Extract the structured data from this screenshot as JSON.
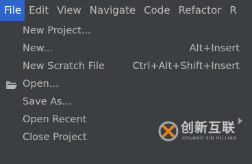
{
  "menubar": {
    "items": [
      {
        "label": "File",
        "active": true
      },
      {
        "label": "Edit"
      },
      {
        "label": "View"
      },
      {
        "label": "Navigate"
      },
      {
        "label": "Code"
      },
      {
        "label": "Refactor"
      },
      {
        "label": "R"
      }
    ]
  },
  "file_menu": {
    "items": [
      {
        "label": "New Project...",
        "shortcut": ""
      },
      {
        "label": "New...",
        "shortcut": "Alt+Insert"
      },
      {
        "label": "New Scratch File",
        "shortcut": "Ctrl+Alt+Shift+Insert"
      },
      {
        "label": "Open...",
        "shortcut": "",
        "icon": "folder-icon"
      },
      {
        "label": "Save As...",
        "shortcut": ""
      },
      {
        "label": "Open Recent",
        "shortcut": "",
        "submenu": true
      },
      {
        "label": "Close Project",
        "shortcut": ""
      }
    ]
  },
  "watermark": {
    "text": "创新互联",
    "subtext": "CHUANG XIN HU LIAN"
  },
  "colors": {
    "background": "#3c3f41",
    "text": "#bbbbbb",
    "active_menu": "#2f65ca"
  }
}
